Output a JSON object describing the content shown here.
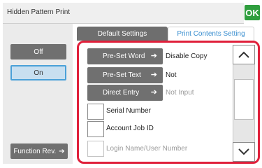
{
  "header": {
    "title": "Hidden Pattern Print",
    "ok_label": "OK"
  },
  "sidebar": {
    "off_label": "Off",
    "on_label": "On",
    "function_review_label": "Function Rev."
  },
  "tabs": [
    {
      "label": "Default Settings",
      "active": false
    },
    {
      "label": "Print Contents Setting",
      "active": true
    }
  ],
  "content": {
    "preset_word": {
      "label": "Pre-Set Word",
      "value": "Disable Copy"
    },
    "preset_text": {
      "label": "Pre-Set Text",
      "value": "Not"
    },
    "direct_entry": {
      "label": "Direct Entry",
      "value": "Not Input"
    },
    "checkboxes": [
      {
        "label": "Serial Number",
        "checked": false,
        "enabled": true
      },
      {
        "label": "Account Job ID",
        "checked": false,
        "enabled": true
      },
      {
        "label": "Login Name/User Number",
        "checked": false,
        "enabled": false
      }
    ]
  },
  "colors": {
    "accent_green": "#2f9e3e",
    "highlight_red": "#e0203b",
    "tab_active_text": "#3b8fd0",
    "button_grey": "#707070"
  },
  "icons": {
    "ok": "checkmark-ok",
    "arrow": "arrow-right-icon",
    "scroll_up": "chevron-up-icon",
    "scroll_down": "chevron-down-icon"
  }
}
